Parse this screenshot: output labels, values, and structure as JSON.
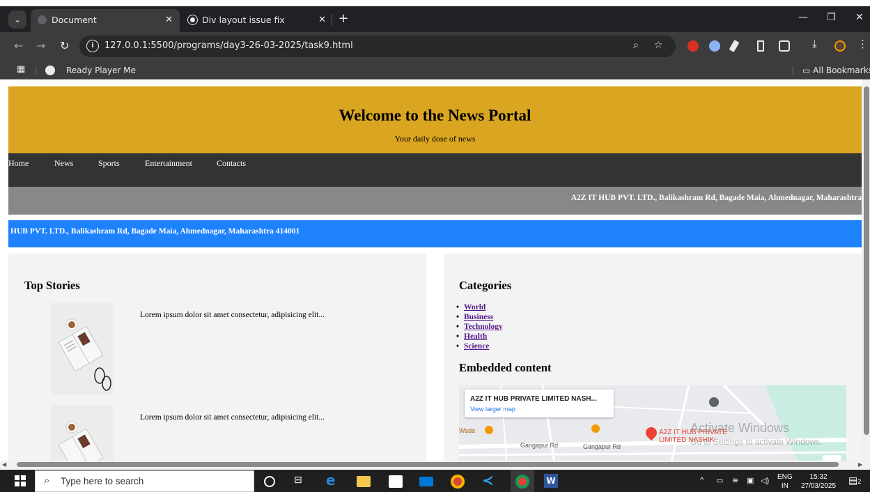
{
  "browser": {
    "tabs": [
      {
        "title": "Document",
        "active": true
      },
      {
        "title": "Div layout issue fix",
        "active": false
      }
    ],
    "url": "127.0.0.1:5500/programs/day3-26-03-2025/task9.html",
    "bookmarks": {
      "item1": "Ready Player Me",
      "all": "All Bookmarks"
    }
  },
  "page": {
    "header": {
      "title": "Welcome to the News Portal",
      "subtitle": "Your daily dose of news"
    },
    "nav": [
      "Home",
      "News",
      "Sports",
      "Entertainment",
      "Contacts"
    ],
    "marquee_gray": "A2Z IT HUB PVT. LTD., Balikashram Rd, Bagade Maia, Ahmednagar, Maharashtra",
    "marquee_blue": "HUB PVT. LTD., Balikashram Rd, Bagade Maia, Ahmednagar, Maharashtra 414001",
    "top_stories": {
      "title": "Top Stories",
      "items": [
        {
          "text": "Lorem ipsum dolor sit amet consectetur, adipisicing elit..."
        },
        {
          "text": "Lorem ipsum dolor sit amet consectetur, adipisicing elit..."
        }
      ]
    },
    "categories": {
      "title": "Categories",
      "items": [
        "World",
        "Business",
        "Technology",
        "Health",
        "Science"
      ]
    },
    "embedded": {
      "title": "Embedded content",
      "map_place": "A2Z IT HUB PRIVATE LIMITED NASH...",
      "map_link": "View larger map",
      "pin_label_1": "A2Z IT HUB PRIVATE",
      "pin_label_2": "LIMITED NASHIK",
      "road1": "Gangapur Rd",
      "road2": "Gangapur Rd",
      "wada": "Wada"
    },
    "watermark": {
      "line1": "Activate Windows",
      "line2": "Go to Settings to activate Windows."
    }
  },
  "taskbar": {
    "search_placeholder": "Type here to search",
    "lang": "ENG",
    "region": "IN",
    "time": "15:32",
    "date": "27/03/2025",
    "notif_count": "2"
  },
  "colors": {
    "header_bg": "#daa520",
    "nav_bg": "#333333",
    "gray_bar": "#888888",
    "blue_bar": "#1e82fc"
  }
}
